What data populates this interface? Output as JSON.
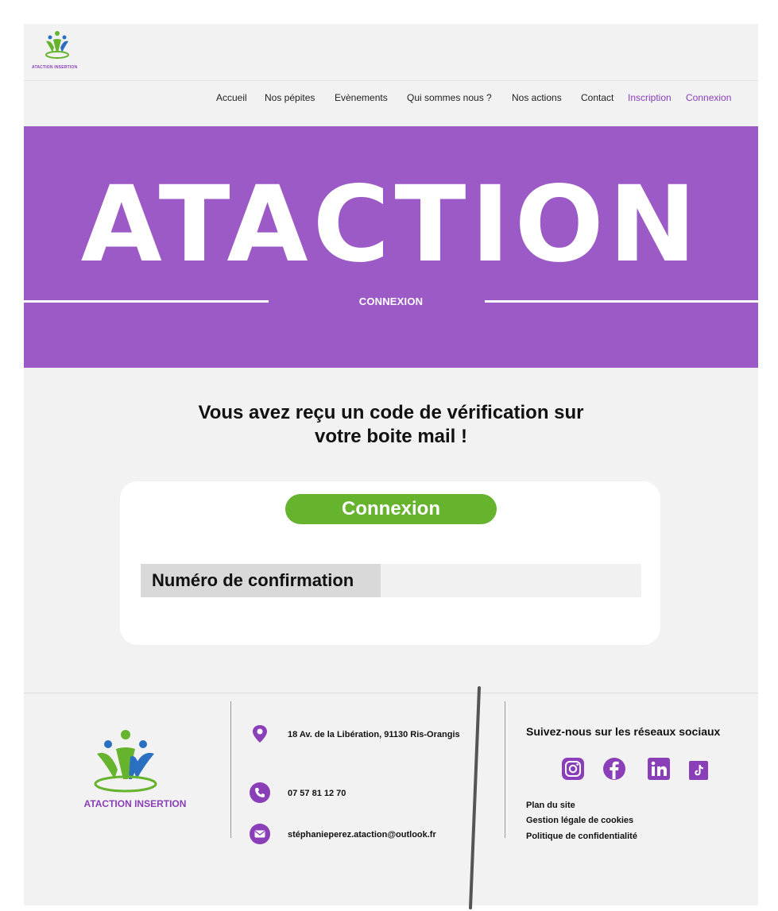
{
  "brand": {
    "small_logo_text": "ATACTION INSERTION",
    "footer_logo_text": "ATACTION INSERTION",
    "purple": "#9b5ac6",
    "green": "#66b32e",
    "blue": "#2a6fc0"
  },
  "nav": {
    "items": [
      {
        "label": "Accueil"
      },
      {
        "label": "Nos pépites"
      },
      {
        "label": "Evènements"
      },
      {
        "label": "Qui sommes nous ?"
      },
      {
        "label": "Nos actions"
      },
      {
        "label": "Contact"
      },
      {
        "label": "Inscription"
      },
      {
        "label": "Connexion"
      }
    ]
  },
  "hero": {
    "title": "ATACTION",
    "subtitle": "CONNEXION"
  },
  "message": {
    "line1": "Vous avez reçu un code de vérification sur",
    "line2": "votre boite mail !"
  },
  "card": {
    "button_label": "Connexion",
    "field_label": "Numéro de confirmation",
    "field_value": ""
  },
  "footer": {
    "address": "18 Av. de la Libération, 91130 Ris-Orangis",
    "phone": "07 57 81 12 70",
    "email": "stéphanieperez.ataction@outlook.fr",
    "social_title": "Suivez-nous sur les réseaux sociaux",
    "social_icons": [
      "instagram-icon",
      "facebook-icon",
      "linkedin-icon",
      "tiktok-icon"
    ],
    "links": [
      "Plan du site",
      "Gestion légale de cookies",
      "Politique de confidentialité"
    ]
  }
}
